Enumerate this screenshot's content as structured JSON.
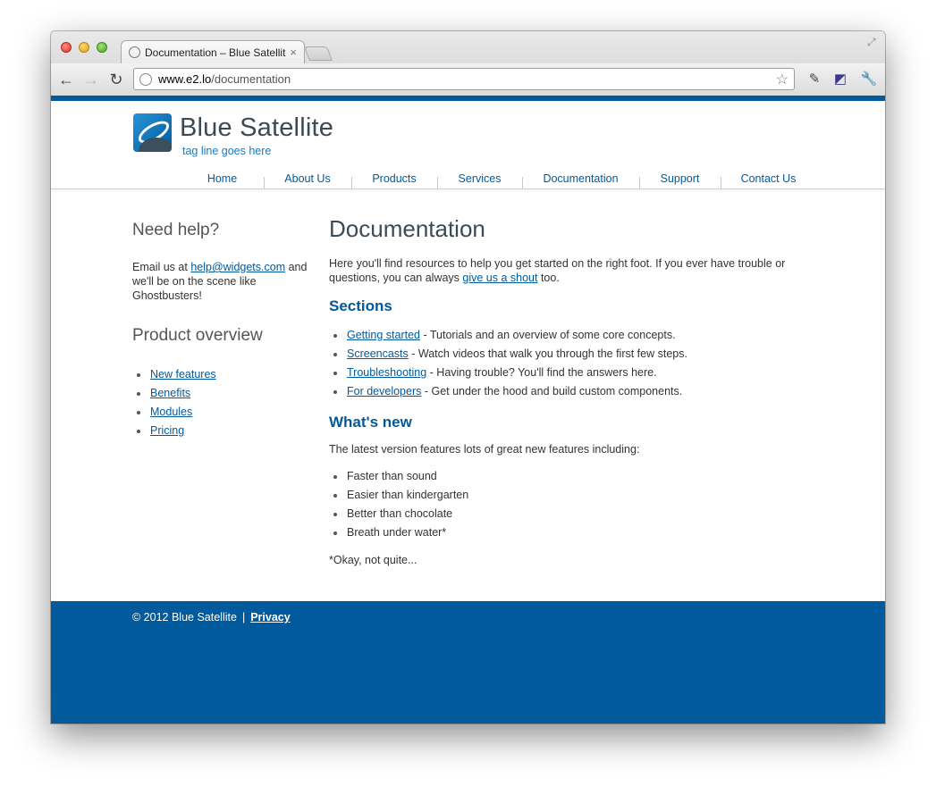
{
  "browser": {
    "tab_title": "Documentation – Blue Satellite",
    "url_host": "www.e2.lo",
    "url_path": "/documentation"
  },
  "site": {
    "name": "Blue Satellite",
    "tagline": "tag line goes here",
    "accent_color": "#005a9c"
  },
  "nav": [
    "Home",
    "About Us",
    "Products",
    "Services",
    "Documentation",
    "Support",
    "Contact Us"
  ],
  "sidebar": {
    "help_heading": "Need help?",
    "help_prefix": "Email us at ",
    "help_email": "help@widgets.com",
    "help_suffix": " and we'll be on the scene like Ghostbusters!",
    "overview_heading": "Product overview",
    "overview_links": [
      "New features",
      "Benefits",
      "Modules",
      "Pricing"
    ]
  },
  "main": {
    "title": "Documentation",
    "intro_prefix": "Here you'll find resources to help you get started on the right foot. If you ever have trouble or questions, you can always ",
    "intro_link": "give us a shout",
    "intro_suffix": " too.",
    "sections_heading": "Sections",
    "sections": [
      {
        "link": "Getting started",
        "desc": " - Tutorials and an overview of some core concepts."
      },
      {
        "link": "Screencasts",
        "desc": " - Watch videos that walk you through the first few steps."
      },
      {
        "link": "Troubleshooting",
        "desc": " - Having trouble? You'll find the answers here."
      },
      {
        "link": "For developers",
        "desc": " - Get under the hood and build custom components."
      }
    ],
    "whatsnew_heading": "What's new",
    "whatsnew_intro": "The latest version features lots of great new features including:",
    "features": [
      "Faster than sound",
      "Easier than kindergarten",
      "Better than chocolate",
      "Breath under water*"
    ],
    "footnote": "*Okay, not quite..."
  },
  "footer": {
    "copyright": "© 2012 Blue Satellite",
    "separator": "|",
    "privacy": "Privacy"
  }
}
